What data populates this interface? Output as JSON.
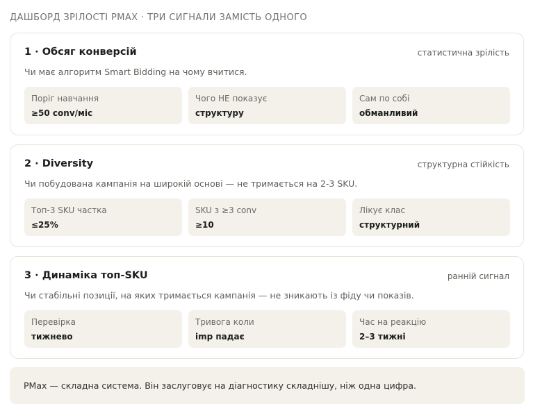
{
  "header": {
    "title": "ДАШБОРД ЗРІЛОСТІ PMAX · ТРИ СИГНАЛИ ЗАМІСТЬ ОДНОГО"
  },
  "cards": [
    {
      "title": "1 · Обсяг конверсій",
      "tag": "статистична зрілість",
      "description": "Чи має алгоритм Smart Bidding на чому вчитися.",
      "metrics": [
        {
          "label": "Поріг навчання",
          "value": "≥50 conv/міс"
        },
        {
          "label": "Чого НЕ показує",
          "value": "структуру"
        },
        {
          "label": "Сам по собі",
          "value": "обманливий"
        }
      ]
    },
    {
      "title": "2 · Diversity",
      "tag": "структурна стійкість",
      "description": "Чи побудована кампанія на широкій основі — не тримається на 2-3 SKU.",
      "metrics": [
        {
          "label": "Топ-3 SKU частка",
          "value": "≤25%"
        },
        {
          "label": "SKU з ≥3 conv",
          "value": "≥10"
        },
        {
          "label": "Лікує клас",
          "value": "структурний"
        }
      ]
    },
    {
      "title": "3 · Динаміка топ-SKU",
      "tag": "ранній сигнал",
      "description": "Чи стабільні позиції, на яких тримається кампанія — не зникають із фіду чи показів.",
      "metrics": [
        {
          "label": "Перевірка",
          "value": "тижнево"
        },
        {
          "label": "Тривога коли",
          "value": "imp падає"
        },
        {
          "label": "Час на реакцію",
          "value": "2–3 тижні"
        }
      ]
    }
  ],
  "footer": {
    "text": "PMax — складна система. Він заслуговує на діагностику складнішу, ніж одна цифра."
  }
}
